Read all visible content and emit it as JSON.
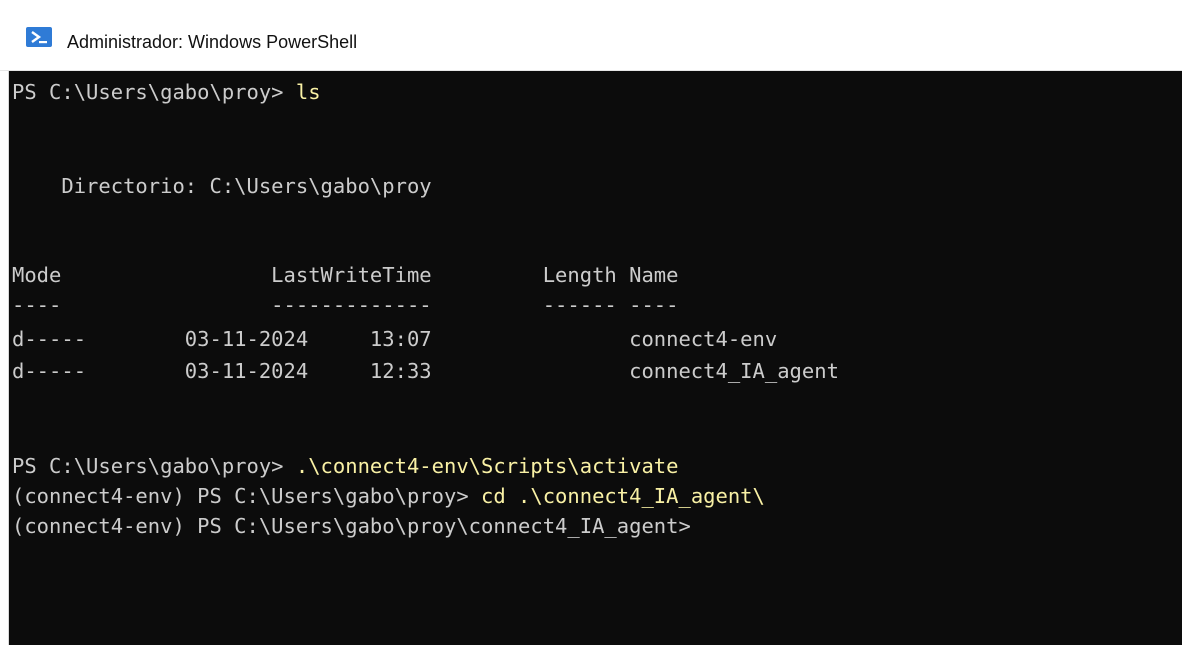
{
  "window": {
    "icon": "powershell-icon",
    "title": "Administrador: Windows PowerShell"
  },
  "console": {
    "lines": [
      {
        "prompt": "PS C:\\Users\\gabo\\proy> ",
        "command": "ls"
      },
      {
        "text": "    Directorio: C:\\Users\\gabo\\proy"
      },
      {
        "text": "Mode                 LastWriteTime         Length Name"
      },
      {
        "text": "----                 -------------         ------ ----"
      },
      {
        "text": "d-----        03-11-2024     13:07                connect4-env"
      },
      {
        "text": "d-----        03-11-2024     12:33                connect4_IA_agent"
      },
      {
        "prompt": "PS C:\\Users\\gabo\\proy> ",
        "command": ".\\connect4-env\\Scripts\\activate"
      },
      {
        "prompt": "(connect4-env) PS C:\\Users\\gabo\\proy> ",
        "command": "cd .\\connect4_IA_agent\\"
      },
      {
        "prompt": "(connect4-env) PS C:\\Users\\gabo\\proy\\connect4_IA_agent>",
        "command": ""
      }
    ]
  },
  "colors": {
    "console_background": "#0c0c0c",
    "console_text": "#cccccc",
    "command_text": "#f9f1a5",
    "icon_blue": "#2f7bd6"
  }
}
